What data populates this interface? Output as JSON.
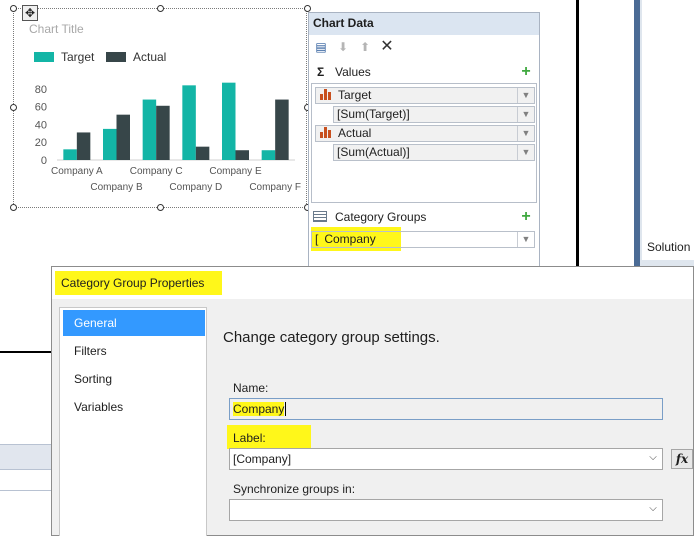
{
  "chart": {
    "title": "Chart Title",
    "move_icon": "move-handle-icon"
  },
  "chart_data": {
    "type": "bar",
    "categories": [
      "Company A",
      "Company B",
      "Company C",
      "Company D",
      "Company E",
      "Company F"
    ],
    "series": [
      {
        "name": "Target",
        "color": "#13b5a6",
        "values": [
          12,
          35,
          68,
          84,
          87,
          11
        ]
      },
      {
        "name": "Actual",
        "color": "#374649",
        "values": [
          31,
          51,
          61,
          15,
          11,
          68
        ]
      }
    ],
    "yticks": [
      "0",
      "20",
      "40",
      "60",
      "80"
    ],
    "ylim": [
      0,
      90
    ],
    "legend": "top-left",
    "grid": false
  },
  "chart_data_pane": {
    "title": "Chart Data",
    "values_label": "Values",
    "values_glyph": "Σ",
    "fields": [
      {
        "name": "Target",
        "expression": "[Sum(Target)]"
      },
      {
        "name": "Actual",
        "expression": "[Sum(Actual)]"
      }
    ],
    "category_groups_label": "Category Groups",
    "category_field": "Company",
    "category_bracket": "["
  },
  "solution_panel": {
    "label": "Solution"
  },
  "dialog": {
    "title": "Category Group Properties",
    "nav": [
      "General",
      "Filters",
      "Sorting",
      "Variables"
    ],
    "active_nav": "General",
    "heading": "Change category group settings.",
    "name_label": "Name:",
    "name_value": "Company",
    "label_label": "Label:",
    "label_value": "[Company]",
    "sync_label": "Synchronize groups in:",
    "sync_value": "",
    "fx_label": "fx"
  },
  "colors": {
    "highlight": "#fff71a",
    "nav_active": "#3399ff",
    "pane_header": "#dbe5f1"
  }
}
